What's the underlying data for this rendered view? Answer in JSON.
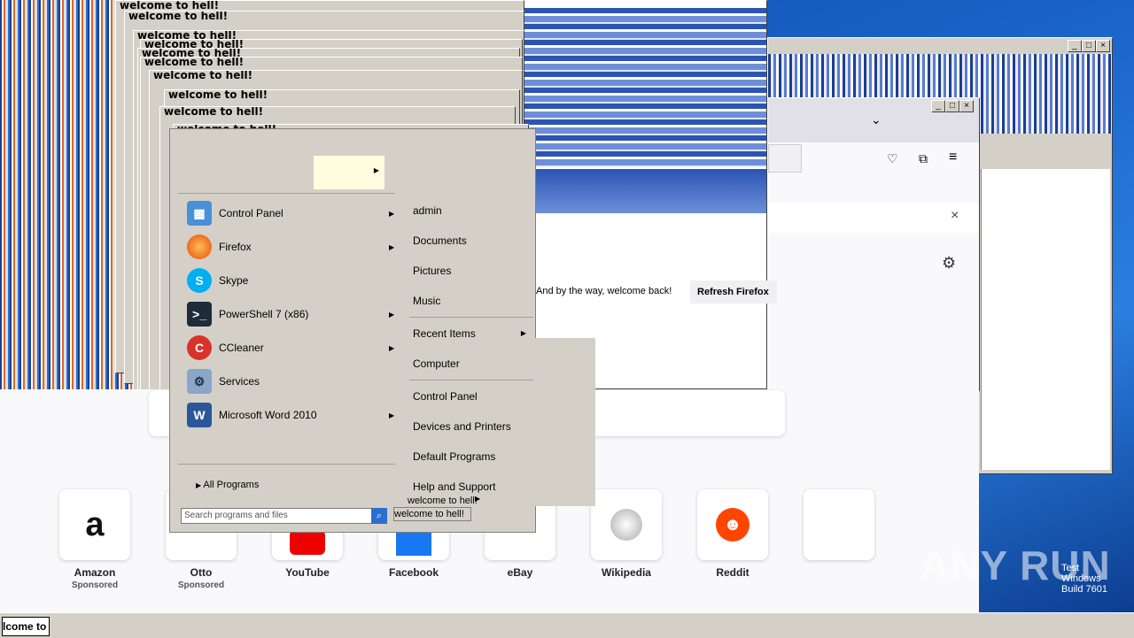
{
  "window_title": "welcome to hell!",
  "glitch_titles": [
    "welcome to hell!",
    "welcome to hell!",
    "welcome to hell!",
    "welcome to hell!",
    "welcome to hell!",
    "welcome to hell!",
    "welcome to hell!",
    "welcome to hell!",
    "welcome to hell!",
    "welcome to hell!"
  ],
  "firefox": {
    "notice": "And by the way, welcome back!",
    "refresh_button": "Refresh Firefox",
    "close_notice": "×",
    "shortcuts": [
      {
        "label": "Amazon",
        "sub": "Sponsored"
      },
      {
        "label": "Otto",
        "sub": "Sponsored"
      },
      {
        "label": "YouTube",
        "sub": ""
      },
      {
        "label": "Facebook",
        "sub": ""
      },
      {
        "label": "eBay",
        "sub": ""
      },
      {
        "label": "Wikipedia",
        "sub": ""
      },
      {
        "label": "Reddit",
        "sub": ""
      }
    ]
  },
  "start_menu": {
    "programs": [
      {
        "label": "Control Panel",
        "icon": "control-panel-icon",
        "has_arrow": true
      },
      {
        "label": "Firefox",
        "icon": "firefox-icon",
        "has_arrow": true
      },
      {
        "label": "Skype",
        "icon": "skype-icon",
        "has_arrow": false
      },
      {
        "label": "PowerShell 7 (x86)",
        "icon": "powershell-icon",
        "has_arrow": true
      },
      {
        "label": "CCleaner",
        "icon": "ccleaner-icon",
        "has_arrow": true
      },
      {
        "label": "Services",
        "icon": "services-icon",
        "has_arrow": false
      },
      {
        "label": "Microsoft Word 2010",
        "icon": "word-icon",
        "has_arrow": true
      }
    ],
    "all_programs": "All Programs",
    "search_placeholder": "Search programs and files",
    "right_items": [
      {
        "label": "admin"
      },
      {
        "label": "Documents"
      },
      {
        "label": "Pictures"
      },
      {
        "label": "Music"
      },
      {
        "label": "Recent Items",
        "has_arrow": true
      },
      {
        "label": "Computer"
      },
      {
        "label": "Control Panel"
      },
      {
        "label": "Devices and Printers"
      },
      {
        "label": "Default Programs"
      },
      {
        "label": "Help and Support"
      }
    ],
    "shutdown_label": "welcome to hell!",
    "shutdown_label2": "welcome to hell!"
  },
  "taskbar": {
    "button": "lcome to"
  },
  "watermark": "ANY RUN",
  "os_id": {
    "line1": "Test",
    "line2": "Windows",
    "line3": "Build 7601"
  },
  "colors": {
    "desktop": "#1a63c9",
    "chrome": "#d4d0c8",
    "firefox_bg": "#f9f9fb"
  }
}
